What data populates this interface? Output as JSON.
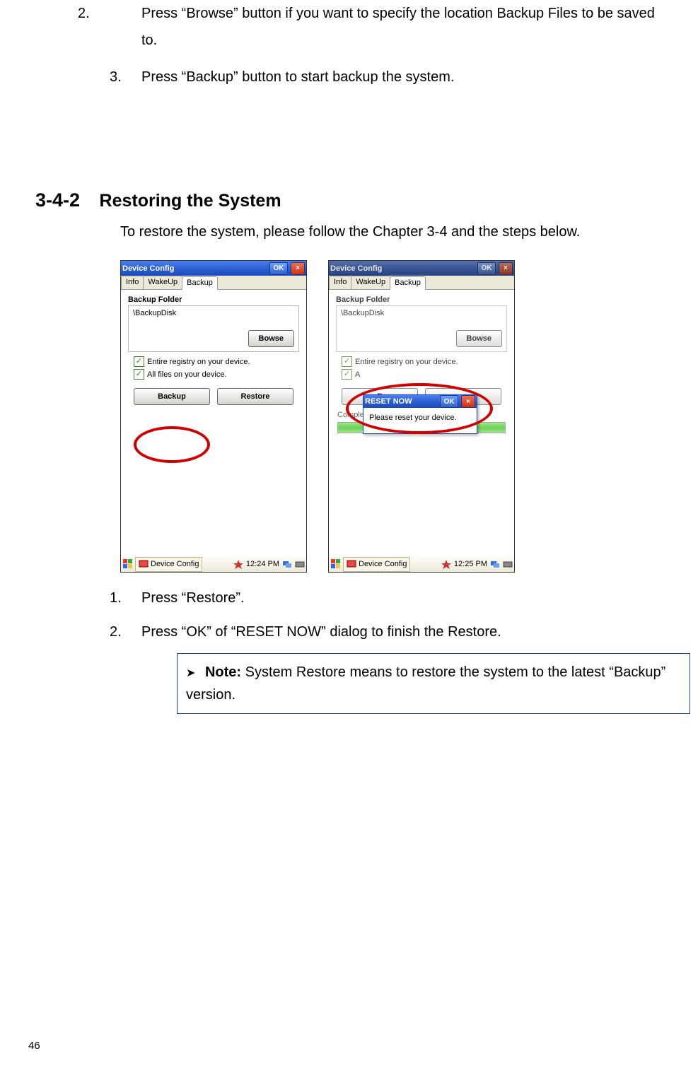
{
  "top_list": {
    "item2_num": "2.",
    "item2_text": "Press “Browse” button if you want to specify the location Backup Files to be saved to.",
    "item3_num": "3.",
    "item3_text": "Press “Backup” button to start backup the system."
  },
  "heading": {
    "num": "3-4-2",
    "title": "Restoring the System"
  },
  "intro": "To restore the system, please follow the Chapter 3-4 and the steps below.",
  "device_left": {
    "title": "Device Config",
    "ok": "OK",
    "tabs": {
      "info": "Info",
      "wakeup": "WakeUp",
      "backup": "Backup"
    },
    "group": "Backup Folder",
    "path": "\\BackupDisk",
    "browse": "Bowse",
    "chk1": "Entire registry on your device.",
    "chk2": "All files on your device.",
    "backup_btn": "Backup",
    "restore_btn": "Restore",
    "task_app": "Device Config",
    "time": "12:24 PM"
  },
  "device_right": {
    "title": "Device Config",
    "ok": "OK",
    "tabs": {
      "info": "Info",
      "wakeup": "WakeUp",
      "backup": "Backup"
    },
    "group": "Backup Folder",
    "path": "\\BackupDisk",
    "browse": "Bowse",
    "chk1": "Entire registry on your device.",
    "chk2": "A",
    "backup_btn": "B",
    "restore_btn": "",
    "status": "Completed.",
    "popup_title": "RESET NOW",
    "popup_ok": "OK",
    "popup_msg": "Please reset your device.",
    "task_app": "Device Config",
    "time": "12:25 PM"
  },
  "bottom_list": {
    "item1_num": "1.",
    "item1_text": "Press “Restore”.",
    "item2_num": "2.",
    "item2_text": "Press “OK” of “RESET NOW” dialog to finish the Restore."
  },
  "note": {
    "label": "Note:",
    "text": " System Restore means to restore the system to the latest “Backup” version."
  },
  "page_number": "46"
}
